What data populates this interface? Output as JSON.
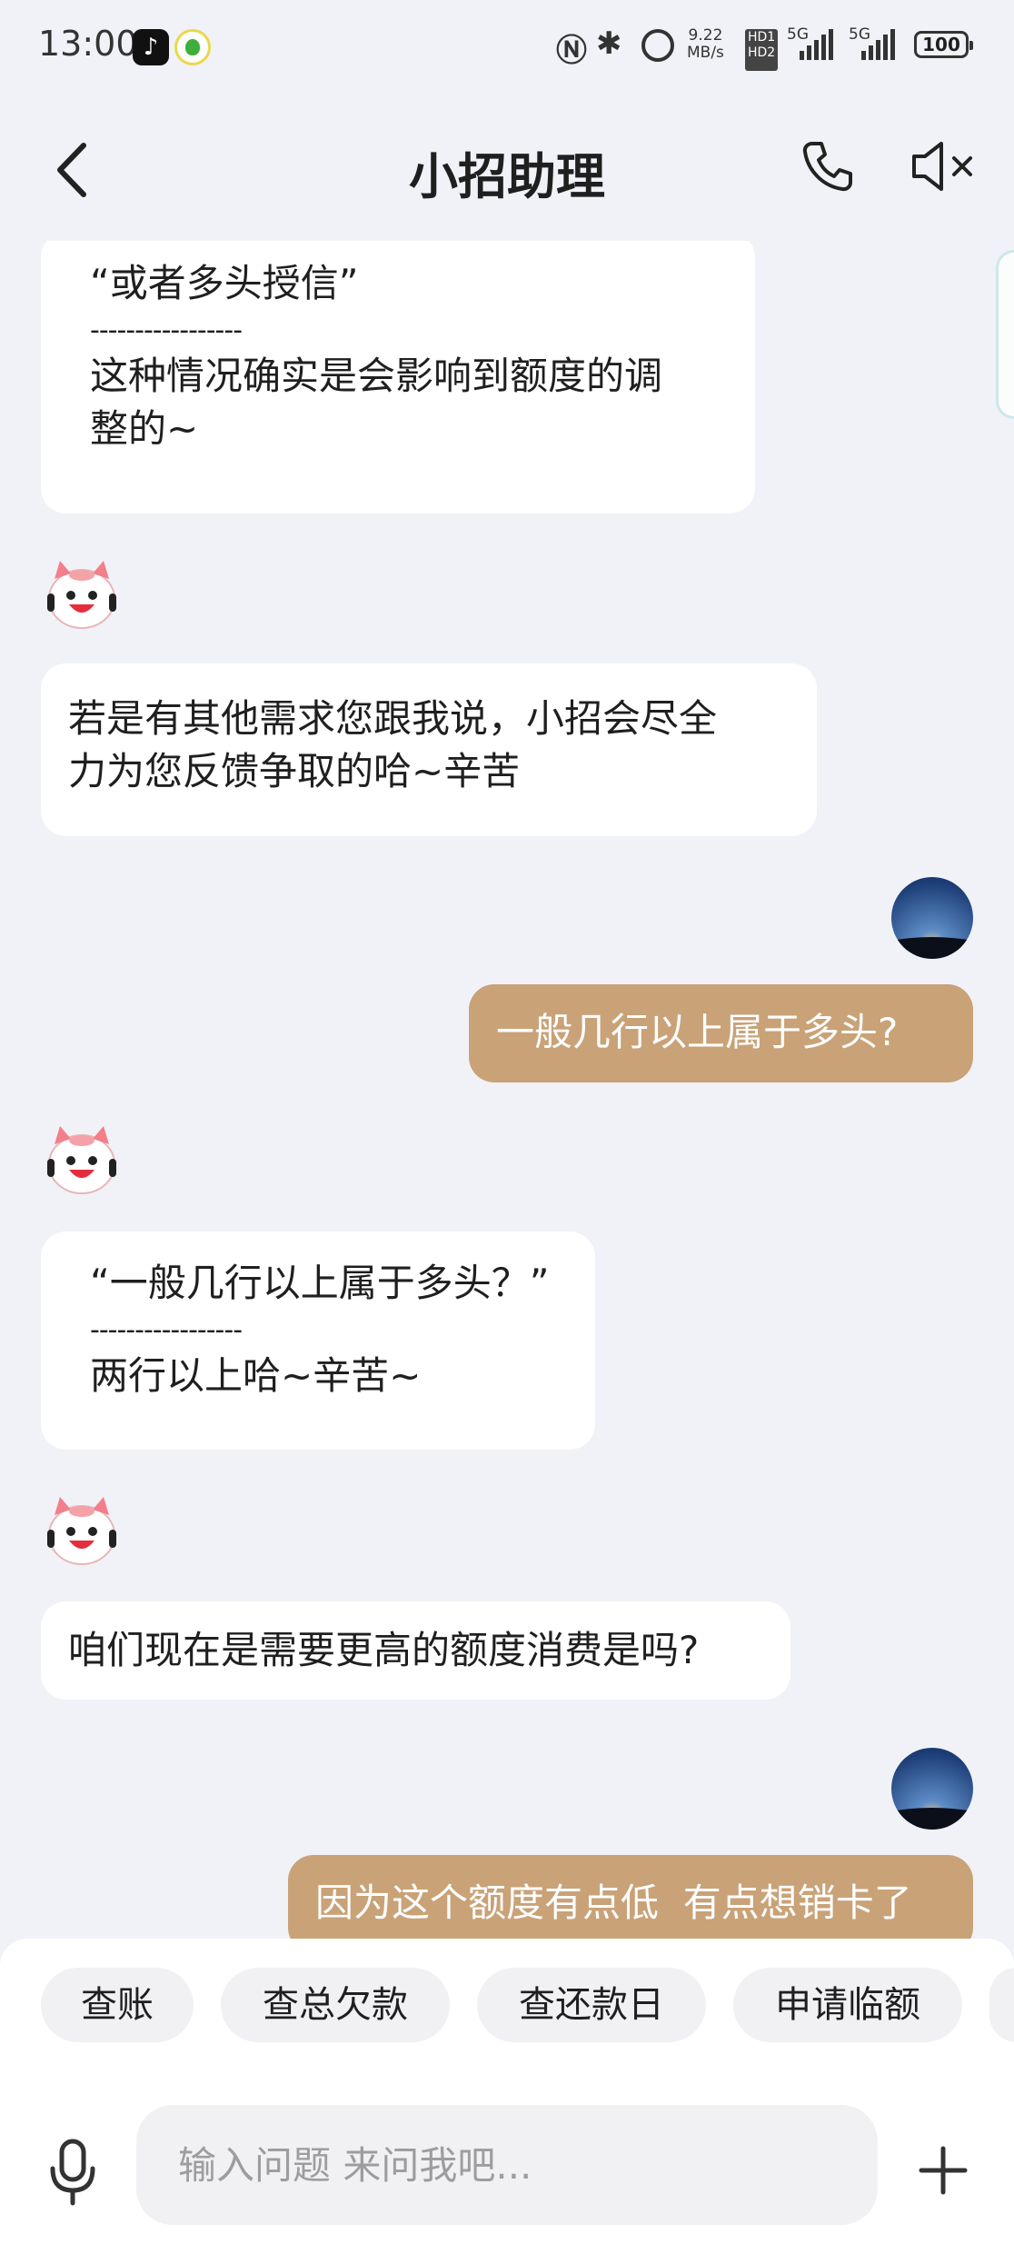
{
  "status_bar": {
    "time": "13:00",
    "speed_value": "9.22",
    "speed_unit": "MB/s",
    "hd1": "HD1",
    "hd2": "HD2",
    "net1": "5G",
    "net2": "5G",
    "battery": "100"
  },
  "header": {
    "title": "小招助理"
  },
  "messages": [
    {
      "sender": "bot",
      "quote": "“或者多头授信”",
      "separator": "-----------------",
      "answer": "这种情况确实是会影响到额度的调\n整的~"
    },
    {
      "sender": "bot",
      "text": "若是有其他需求您跟我说，小招会尽全\n力为您反馈争取的哈~辛苦"
    },
    {
      "sender": "user",
      "text": "一般几行以上属于多头?"
    },
    {
      "sender": "bot",
      "quote": "“一般几行以上属于多头？”",
      "separator": "-----------------",
      "answer": "两行以上哈~辛苦~"
    },
    {
      "sender": "bot",
      "text": "咱们现在是需要更高的额度消费是吗?"
    },
    {
      "sender": "user",
      "text": "因为这个额度有点低  有点想销卡了"
    }
  ],
  "quick_actions": [
    "查账",
    "查总欠款",
    "查还款日",
    "申请临额"
  ],
  "input": {
    "placeholder": "输入问题 来问我吧..."
  },
  "icons": {
    "back": "back-arrow-icon",
    "phone": "phone-icon",
    "mute": "speaker-mute-icon",
    "mic": "microphone-icon",
    "plus": "plus-icon",
    "bot_avatar": "cat-robot-avatar",
    "user_avatar": "starry-sky-avatar"
  },
  "colors": {
    "background": "#f1f2f7",
    "user_bubble": "#c9a278",
    "bot_bubble": "#ffffff"
  }
}
